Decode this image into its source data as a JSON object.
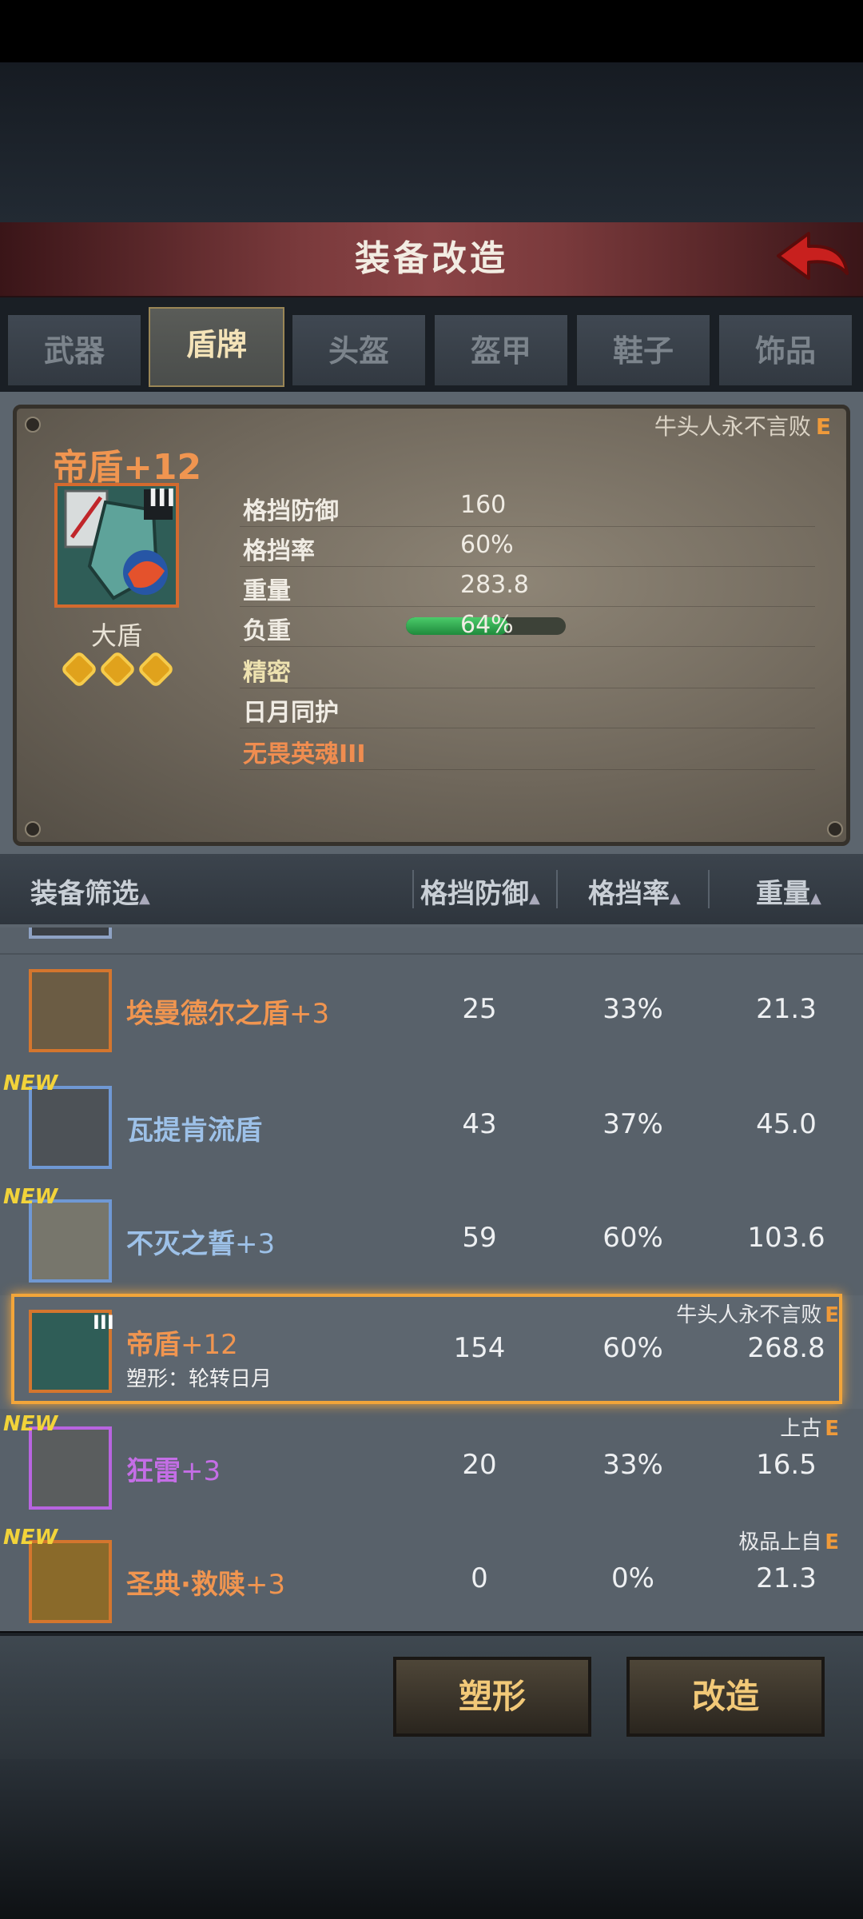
{
  "header": {
    "title": "装备改造"
  },
  "tabs": [
    {
      "label": "武器"
    },
    {
      "label": "盾牌"
    },
    {
      "label": "头盔"
    },
    {
      "label": "盔甲"
    },
    {
      "label": "鞋子"
    },
    {
      "label": "饰品"
    }
  ],
  "active_tab": "盾牌",
  "detail": {
    "owner": "牛头人永不言败",
    "owner_grade": "E",
    "name": "帝盾+12",
    "tier": "III",
    "type": "大盾",
    "stars": 3,
    "attributes": [
      {
        "label": "格挡防御",
        "value": "160"
      },
      {
        "label": "格挡率",
        "value": "60%"
      },
      {
        "label": "重量",
        "value": "283.8"
      },
      {
        "label": "负重",
        "value": "64%"
      },
      {
        "label": "精密",
        "value": ""
      },
      {
        "label": "日月同护",
        "value": ""
      },
      {
        "label": "无畏英魂III",
        "value": ""
      }
    ],
    "load_fraction": 0.64
  },
  "list_header": {
    "filter": "装备筛选",
    "col1": "格挡防御",
    "col2": "格挡率",
    "col3": "重量"
  },
  "items": [
    {
      "name": "埃曼德尔之盾",
      "plus": "+3",
      "block": "25",
      "rate": "33%",
      "weight": "21.3",
      "new": "",
      "tag": "",
      "grade": "",
      "sub": ""
    },
    {
      "name": "瓦提肯流盾",
      "plus": "",
      "block": "43",
      "rate": "37%",
      "weight": "45.0",
      "new": "NEW",
      "tag": "",
      "grade": "",
      "sub": ""
    },
    {
      "name": "不灭之誓",
      "plus": "+3",
      "block": "59",
      "rate": "60%",
      "weight": "103.6",
      "new": "NEW",
      "tag": "",
      "grade": "",
      "sub": ""
    },
    {
      "name": "帝盾",
      "plus": "+12",
      "block": "154",
      "rate": "60%",
      "weight": "268.8",
      "new": "",
      "tag": "牛头人永不言败",
      "grade": "E",
      "sub": "塑形：轮转日月",
      "tier": "III"
    },
    {
      "name": "狂雷",
      "plus": "+3",
      "block": "20",
      "rate": "33%",
      "weight": "16.5",
      "new": "NEW",
      "tag": "上古",
      "grade": "E",
      "sub": ""
    },
    {
      "name": "圣典·救赎",
      "plus": "+3",
      "block": "0",
      "rate": "0%",
      "weight": "21.3",
      "new": "NEW",
      "tag": "极品上自",
      "grade": "E",
      "sub": ""
    }
  ],
  "buttons": {
    "reshape": "塑形",
    "modify": "改造"
  },
  "colors": {
    "accent": "#f2a53a",
    "name_orange": "#f09550",
    "name_blue": "#9dc1e8",
    "name_purple": "#c46ee6",
    "new_tag": "#f2d33a"
  }
}
